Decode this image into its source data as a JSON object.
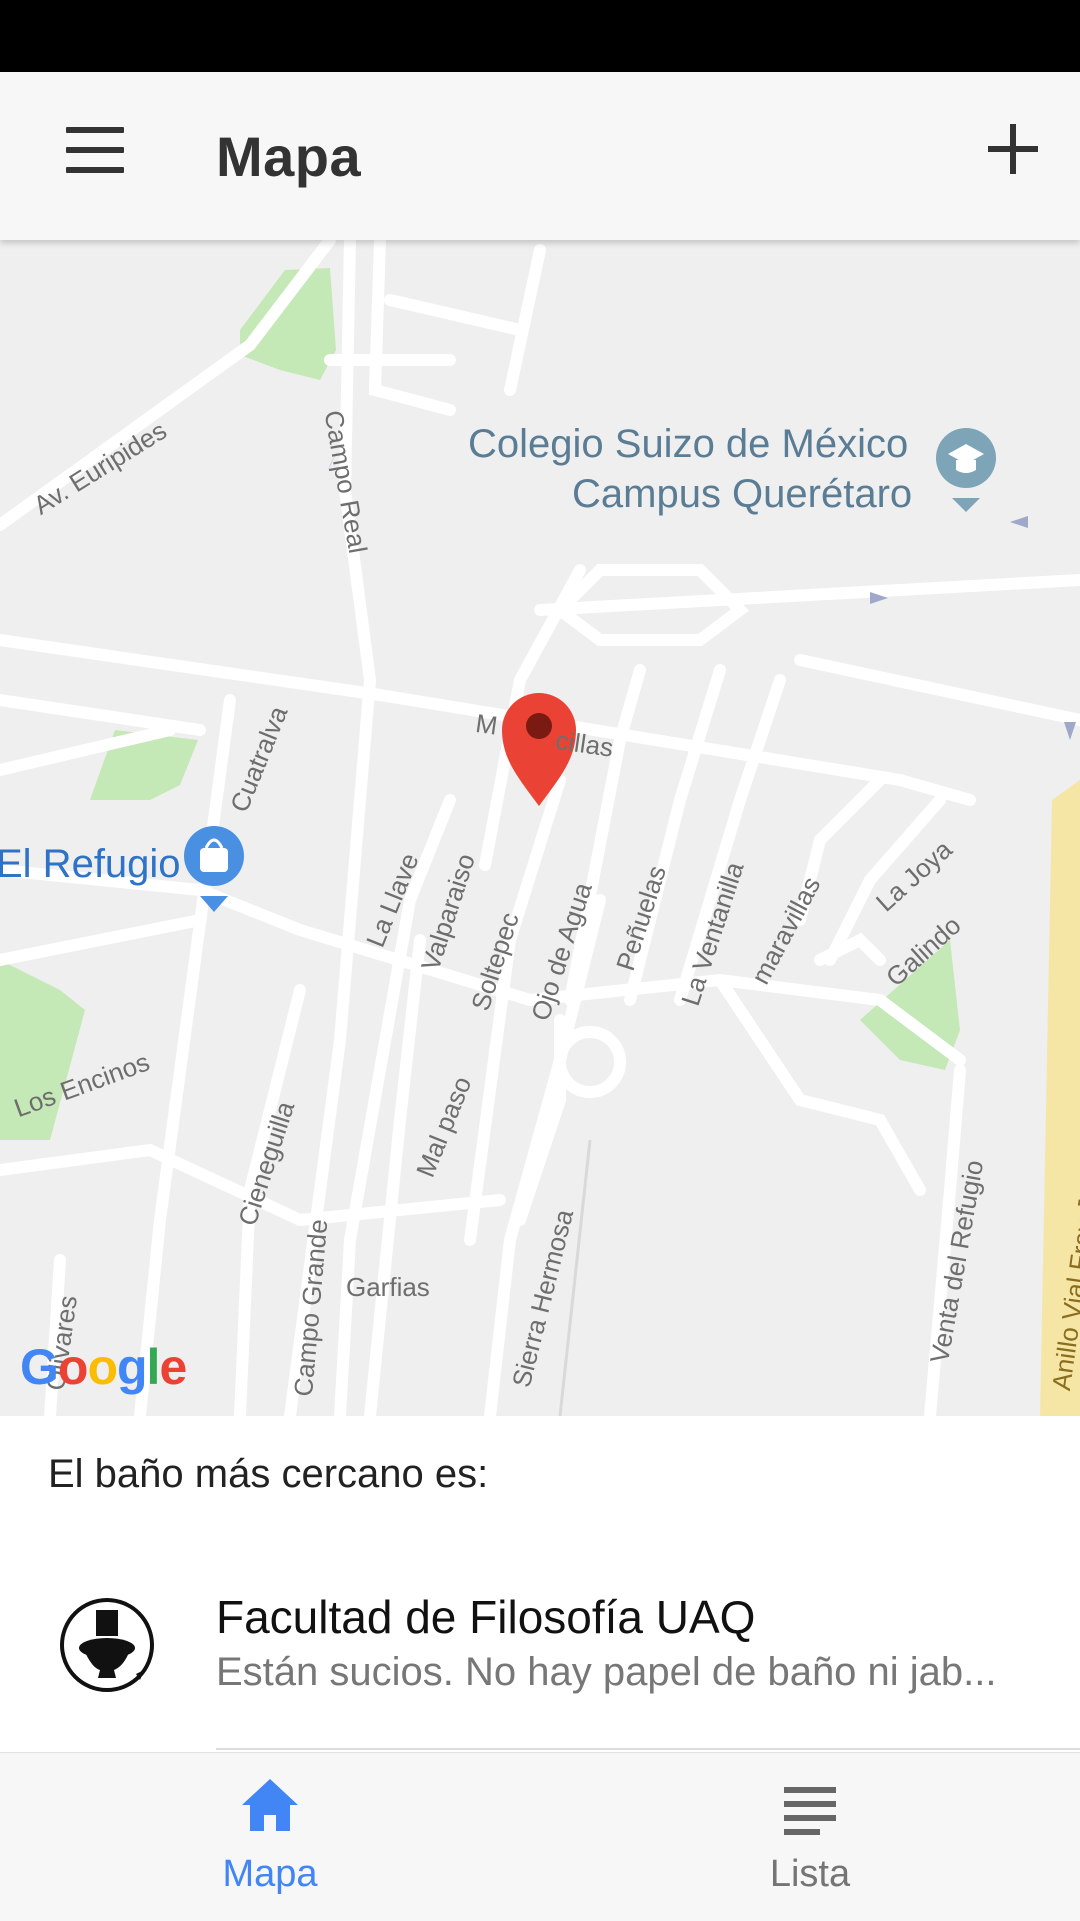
{
  "app_bar": {
    "title": "Mapa"
  },
  "map": {
    "streets": [
      "Av. Euripides",
      "Campo Real",
      "Cuatralva",
      "La Llave",
      "Valparaiso",
      "Soltepec",
      "Ojo de Agua",
      "Peñuelas",
      "La Ventanilla",
      "maravillas",
      "La Joya",
      "Galindo",
      "Los Encinos",
      "Cieneguilla",
      "Mal paso",
      "Campo Grande",
      "Garfias",
      "Sierra Hermosa",
      "Venta del Refugio",
      "Olivares",
      "Anillo Vial Fray Junípero Serra",
      "M",
      "cillas"
    ],
    "pois": {
      "school_line1": "Colegio Suizo de México",
      "school_line2": "Campus Querétaro",
      "shop": "El Refugio"
    },
    "attribution": "Google",
    "colors": {
      "marker": "#ea4335",
      "park": "#c5e8b7",
      "road": "#ffffff",
      "highway": "#f6e6a6"
    }
  },
  "nearest": {
    "label": "El baño más cercano es:",
    "title": "Facultad de Filosofía UAQ",
    "subtitle": "Están sucios. No hay papel de baño ni jab..."
  },
  "bottom_nav": {
    "items": [
      {
        "label": "Mapa",
        "icon": "home-icon",
        "active": true
      },
      {
        "label": "Lista",
        "icon": "list-icon",
        "active": false
      }
    ],
    "accent": "#4285f4"
  }
}
